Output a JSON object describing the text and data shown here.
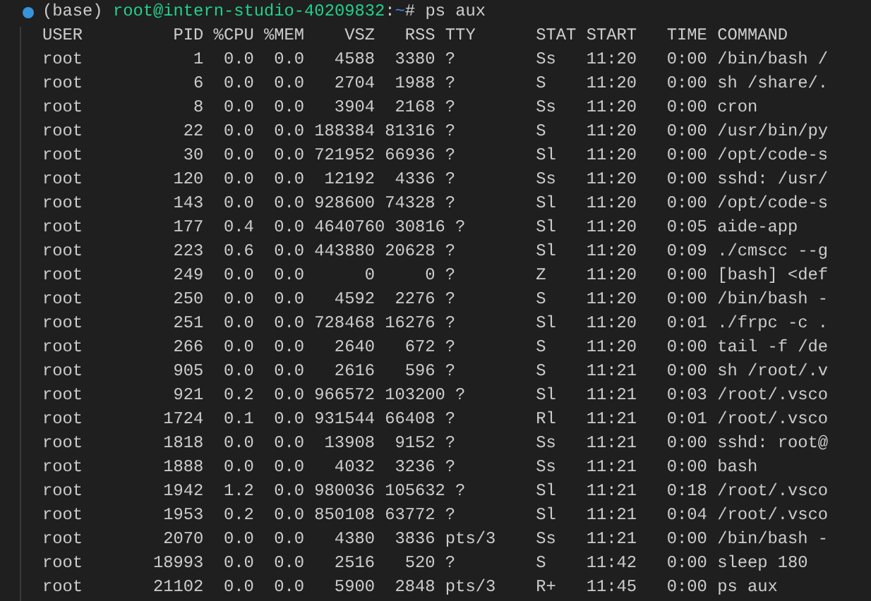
{
  "terminal": {
    "prompt": {
      "env": "(base)",
      "user_host": "root@intern-studio-40209832",
      "separator": ":",
      "path": "~",
      "symbol": "#",
      "command": "ps aux"
    },
    "header": "USER         PID %CPU %MEM    VSZ   RSS TTY      STAT START   TIME COMMAND",
    "rows": [
      "root           1  0.0  0.0   4588  3380 ?        Ss   11:20   0:00 /bin/bash /",
      "root           6  0.0  0.0   2704  1988 ?        S    11:20   0:00 sh /share/.",
      "root           8  0.0  0.0   3904  2168 ?        Ss   11:20   0:00 cron",
      "root          22  0.0  0.0 188384 81316 ?        S    11:20   0:00 /usr/bin/py",
      "root          30  0.0  0.0 721952 66936 ?        Sl   11:20   0:00 /opt/code-s",
      "root         120  0.0  0.0  12192  4336 ?        Ss   11:20   0:00 sshd: /usr/",
      "root         143  0.0  0.0 928600 74328 ?        Sl   11:20   0:00 /opt/code-s",
      "root         177  0.4  0.0 4640760 30816 ?       Sl   11:20   0:05 aide-app",
      "root         223  0.6  0.0 443880 20628 ?        Sl   11:20   0:09 ./cmscc --g",
      "root         249  0.0  0.0      0     0 ?        Z    11:20   0:00 [bash] <def",
      "root         250  0.0  0.0   4592  2276 ?        S    11:20   0:00 /bin/bash -",
      "root         251  0.0  0.0 728468 16276 ?        Sl   11:20   0:01 ./frpc -c .",
      "root         266  0.0  0.0   2640   672 ?        S    11:20   0:00 tail -f /de",
      "root         905  0.0  0.0   2616   596 ?        S    11:21   0:00 sh /root/.v",
      "root         921  0.2  0.0 966572 103200 ?       Sl   11:21   0:03 /root/.vsco",
      "root        1724  0.1  0.0 931544 66408 ?        Rl   11:21   0:01 /root/.vsco",
      "root        1818  0.0  0.0  13908  9152 ?        Ss   11:21   0:00 sshd: root@",
      "root        1888  0.0  0.0   4032  3236 ?        Ss   11:21   0:00 bash",
      "root        1942  1.2  0.0 980036 105632 ?       Sl   11:21   0:18 /root/.vsco",
      "root        1953  0.2  0.0 850108 63772 ?        Sl   11:21   0:04 /root/.vsco",
      "root        2070  0.0  0.0   4380  3836 pts/3    Ss   11:21   0:00 /bin/bash -",
      "root       18993  0.0  0.0   2516   520 ?        S    11:42   0:00 sleep 180",
      "root       21102  0.0  0.0   5900  2848 pts/3    R+   11:45   0:00 ps aux"
    ]
  }
}
